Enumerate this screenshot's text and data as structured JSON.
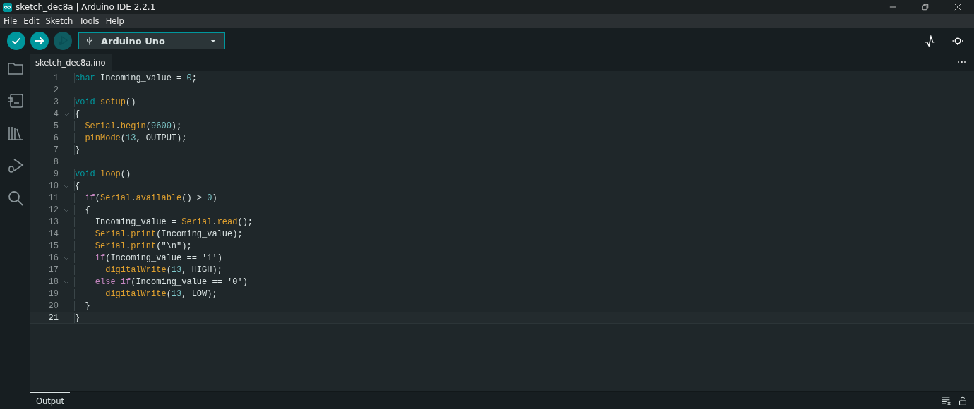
{
  "window": {
    "title": "sketch_dec8a | Arduino IDE 2.2.1"
  },
  "menu": [
    "File",
    "Edit",
    "Sketch",
    "Tools",
    "Help"
  ],
  "toolbar": {
    "buttons": [
      {
        "kind": "verify",
        "disabled": false
      },
      {
        "kind": "upload",
        "disabled": false
      },
      {
        "kind": "debug",
        "disabled": true
      }
    ],
    "board": "Arduino Uno"
  },
  "sidebar": {
    "items": [
      {
        "kind": "folder"
      },
      {
        "kind": "board"
      },
      {
        "kind": "library"
      },
      {
        "kind": "debug"
      },
      {
        "kind": "search"
      }
    ]
  },
  "tabs": [
    {
      "label": "sketch_dec8a.ino",
      "selected": true
    }
  ],
  "editor": {
    "lines": [
      {
        "number": "1",
        "tokens": [
          {
            "text": "char",
            "kind": "type"
          },
          {
            "text": " Incoming_value = ",
            "kind": "plain"
          },
          {
            "text": "0",
            "kind": "number"
          },
          {
            "text": ";",
            "kind": "plain"
          }
        ]
      },
      {
        "number": "2"
      },
      {
        "number": "3",
        "tokens": [
          {
            "text": "void ",
            "kind": "type"
          },
          {
            "text": "setup",
            "kind": "func"
          },
          {
            "text": "()",
            "kind": "plain"
          }
        ]
      },
      {
        "number": "4",
        "fold": true,
        "tokens": [
          {
            "text": "{",
            "kind": "plain"
          }
        ]
      },
      {
        "number": "5",
        "tokens": [
          {
            "text": "  Serial",
            "kind": "func"
          },
          {
            "text": ".",
            "kind": "plain"
          },
          {
            "text": "begin",
            "kind": "func"
          },
          {
            "text": "(",
            "kind": "plain"
          },
          {
            "text": "9600",
            "kind": "number"
          },
          {
            "text": ");",
            "kind": "plain"
          }
        ]
      },
      {
        "number": "6",
        "tokens": [
          {
            "text": "  pinMode",
            "kind": "func"
          },
          {
            "text": "(",
            "kind": "plain"
          },
          {
            "text": "13",
            "kind": "number"
          },
          {
            "text": ", OUTPUT);",
            "kind": "plain"
          }
        ]
      },
      {
        "number": "7",
        "tokens": [
          {
            "text": "}",
            "kind": "plain"
          }
        ]
      },
      {
        "number": "8"
      },
      {
        "number": "9",
        "tokens": [
          {
            "text": "void ",
            "kind": "type"
          },
          {
            "text": "loop",
            "kind": "func"
          },
          {
            "text": "()",
            "kind": "plain"
          }
        ]
      },
      {
        "number": "10",
        "fold": true,
        "tokens": [
          {
            "text": "{",
            "kind": "plain"
          }
        ]
      },
      {
        "number": "11",
        "tokens": [
          {
            "text": "  if",
            "kind": "keyword"
          },
          {
            "text": "(",
            "kind": "plain"
          },
          {
            "text": "Serial",
            "kind": "func"
          },
          {
            "text": ".",
            "kind": "plain"
          },
          {
            "text": "available",
            "kind": "func"
          },
          {
            "text": "() > ",
            "kind": "plain"
          },
          {
            "text": "0",
            "kind": "number"
          },
          {
            "text": ")",
            "kind": "plain"
          }
        ]
      },
      {
        "number": "12",
        "fold": true,
        "tokens": [
          {
            "text": "  {",
            "kind": "plain"
          }
        ]
      },
      {
        "number": "13",
        "tokens": [
          {
            "text": "    Incoming_value = ",
            "kind": "plain"
          },
          {
            "text": "Serial",
            "kind": "func"
          },
          {
            "text": ".",
            "kind": "plain"
          },
          {
            "text": "read",
            "kind": "func"
          },
          {
            "text": "();",
            "kind": "plain"
          }
        ]
      },
      {
        "number": "14",
        "tokens": [
          {
            "text": "    Serial",
            "kind": "func"
          },
          {
            "text": ".",
            "kind": "plain"
          },
          {
            "text": "print",
            "kind": "func"
          },
          {
            "text": "(Incoming_value);",
            "kind": "plain"
          }
        ]
      },
      {
        "number": "15",
        "tokens": [
          {
            "text": "    Serial",
            "kind": "func"
          },
          {
            "text": ".",
            "kind": "plain"
          },
          {
            "text": "print",
            "kind": "func"
          },
          {
            "text": "(",
            "kind": "plain"
          },
          {
            "text": "\"\\n\"",
            "kind": "string"
          },
          {
            "text": ");",
            "kind": "plain"
          }
        ]
      },
      {
        "number": "16",
        "fold": true,
        "tokens": [
          {
            "text": "    if",
            "kind": "keyword"
          },
          {
            "text": "(Incoming_value == ",
            "kind": "plain"
          },
          {
            "text": "'1'",
            "kind": "string"
          },
          {
            "text": ")",
            "kind": "plain"
          }
        ]
      },
      {
        "number": "17",
        "tokens": [
          {
            "text": "      digitalWrite",
            "kind": "func"
          },
          {
            "text": "(",
            "kind": "plain"
          },
          {
            "text": "13",
            "kind": "number"
          },
          {
            "text": ", HIGH);",
            "kind": "plain"
          }
        ]
      },
      {
        "number": "18",
        "fold": true,
        "tokens": [
          {
            "text": "    else if",
            "kind": "keyword"
          },
          {
            "text": "(Incoming_value == ",
            "kind": "plain"
          },
          {
            "text": "'0'",
            "kind": "string"
          },
          {
            "text": ")",
            "kind": "plain"
          }
        ]
      },
      {
        "number": "19",
        "tokens": [
          {
            "text": "      digitalWrite",
            "kind": "func"
          },
          {
            "text": "(",
            "kind": "plain"
          },
          {
            "text": "13",
            "kind": "number"
          },
          {
            "text": ", LOW);",
            "kind": "plain"
          }
        ]
      },
      {
        "number": "20",
        "tokens": [
          {
            "text": "  }",
            "kind": "plain"
          }
        ]
      },
      {
        "number": "21",
        "current": true,
        "tokens": [
          {
            "text": "}",
            "kind": "plain"
          }
        ]
      }
    ]
  },
  "panel": {
    "tabs": [
      {
        "label": "Output",
        "selected": true
      }
    ]
  }
}
